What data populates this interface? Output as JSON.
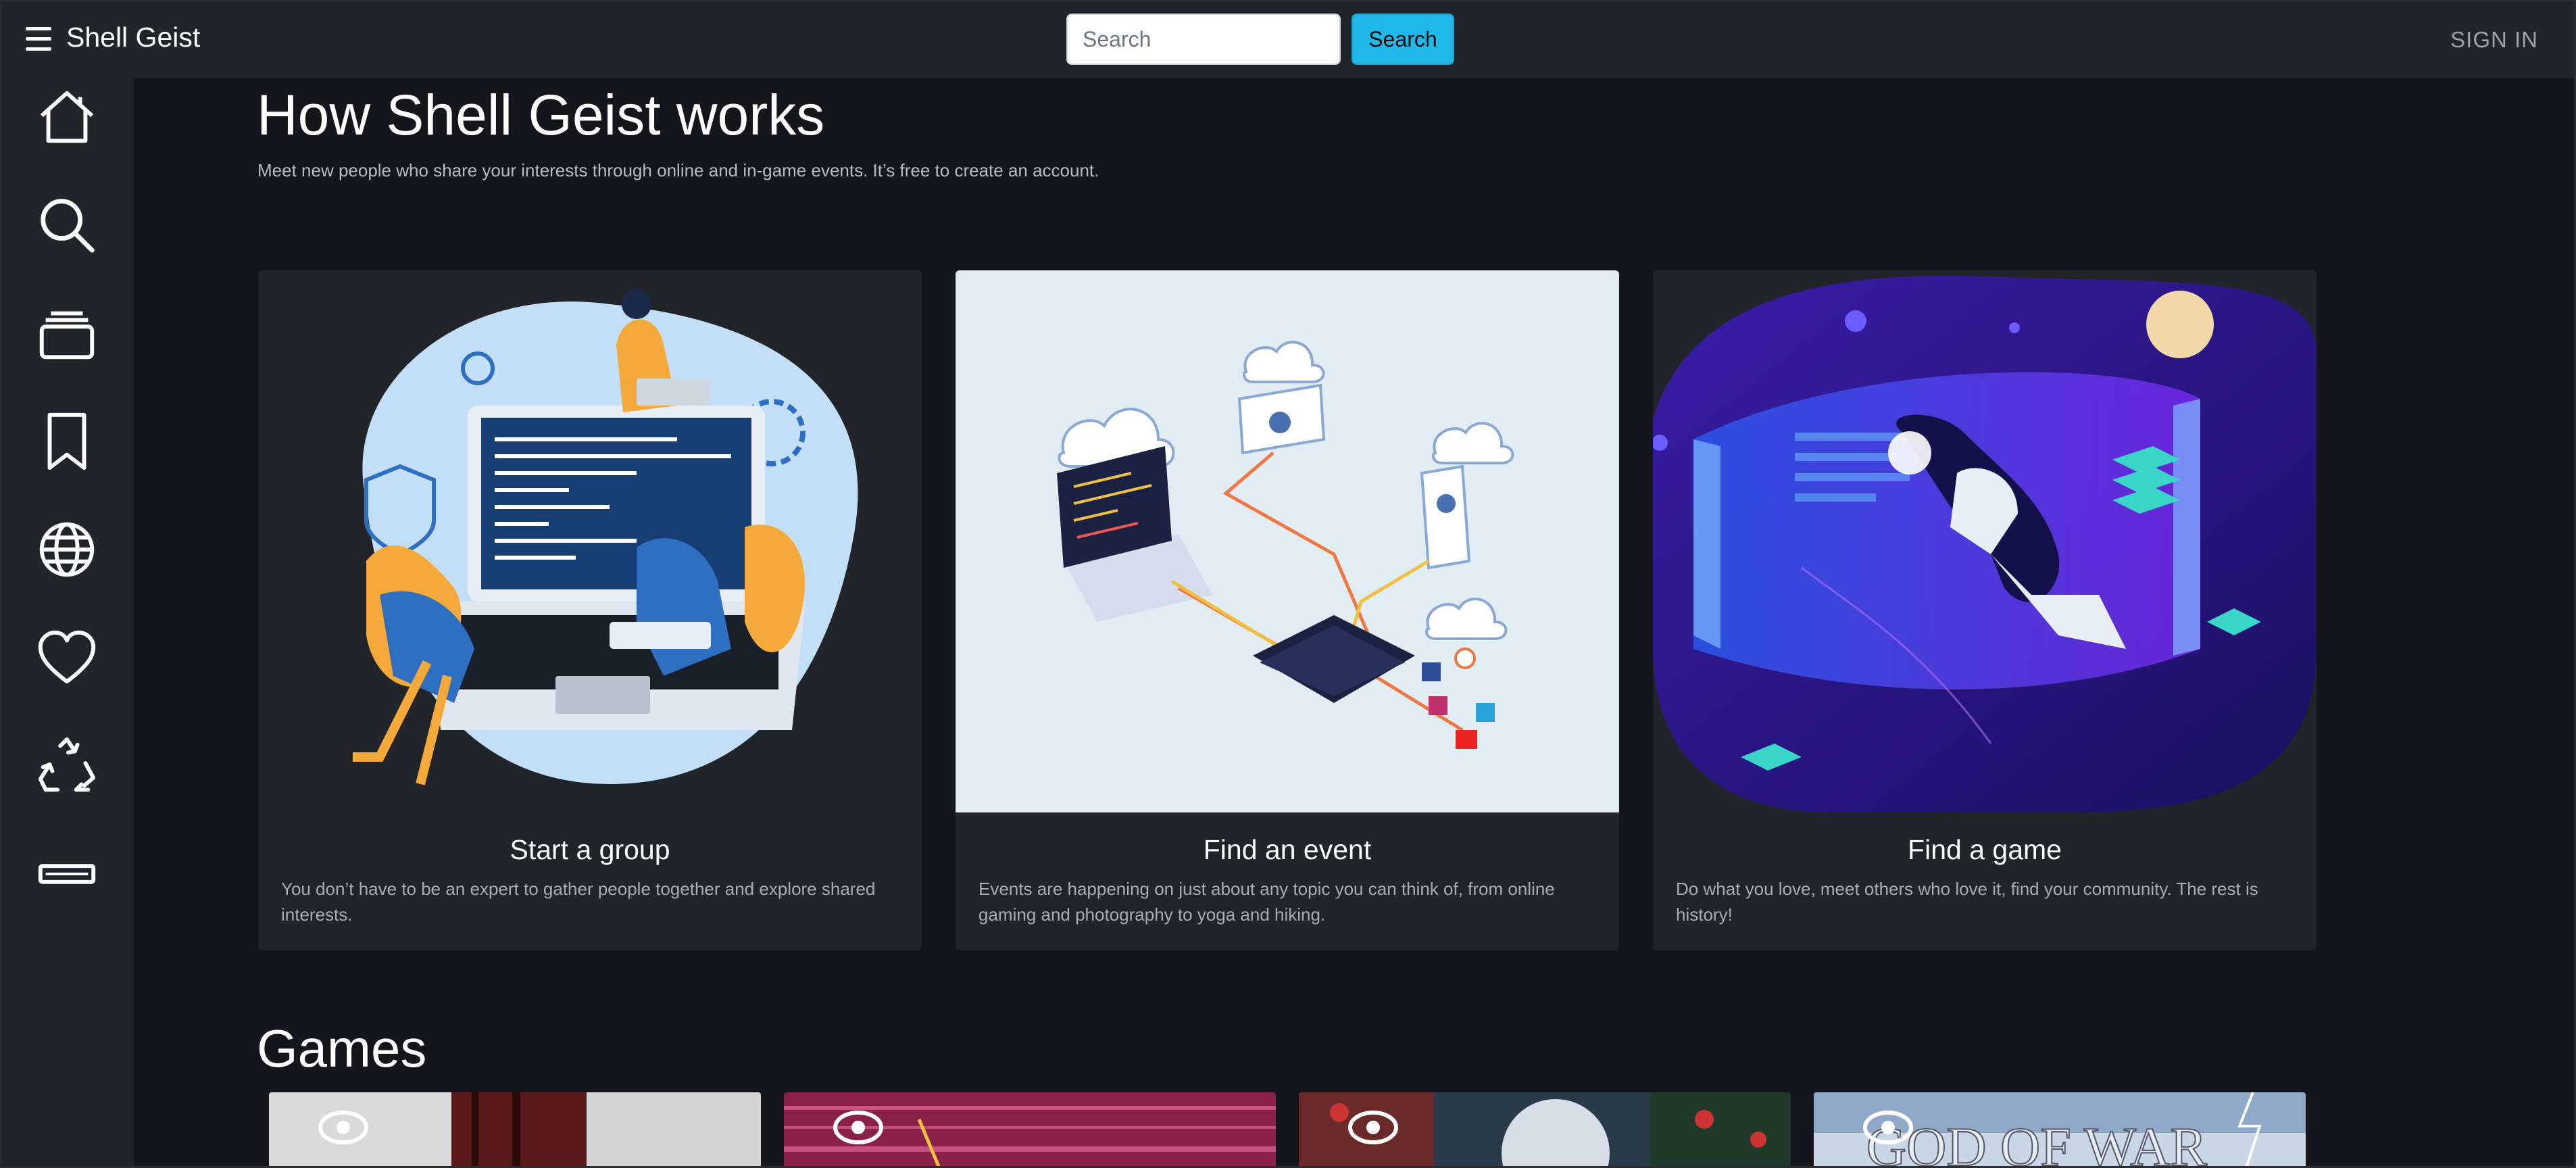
{
  "header": {
    "brand": "Shell Geist",
    "search_placeholder": "Search",
    "search_button": "Search",
    "signin": "SIGN IN"
  },
  "sidebar": {
    "items": [
      {
        "icon": "home-icon"
      },
      {
        "icon": "search-icon"
      },
      {
        "icon": "stack-icon"
      },
      {
        "icon": "bookmark-icon"
      },
      {
        "icon": "globe-icon"
      },
      {
        "icon": "heart-icon"
      },
      {
        "icon": "recycle-icon"
      },
      {
        "icon": "ticket-icon"
      }
    ]
  },
  "main": {
    "title": "How Shell Geist works",
    "lead": "Meet new people who share your interests through online and in-game events. It’s free to create an account.",
    "cards": [
      {
        "title": "Start a group",
        "text": "You don’t have to be an expert to gather people together and explore shared interests."
      },
      {
        "title": "Find an event",
        "text": "Events are happening on just about any topic you can think of, from online gaming and photography to yoga and hiking."
      },
      {
        "title": "Find a game",
        "text": "Do what you love, meet others who love it, find your community. The rest is history!"
      }
    ],
    "games_heading": "Games"
  },
  "colors": {
    "topbar": "#212529",
    "page_bg": "#15161b",
    "accent": "#1fb8e8"
  }
}
